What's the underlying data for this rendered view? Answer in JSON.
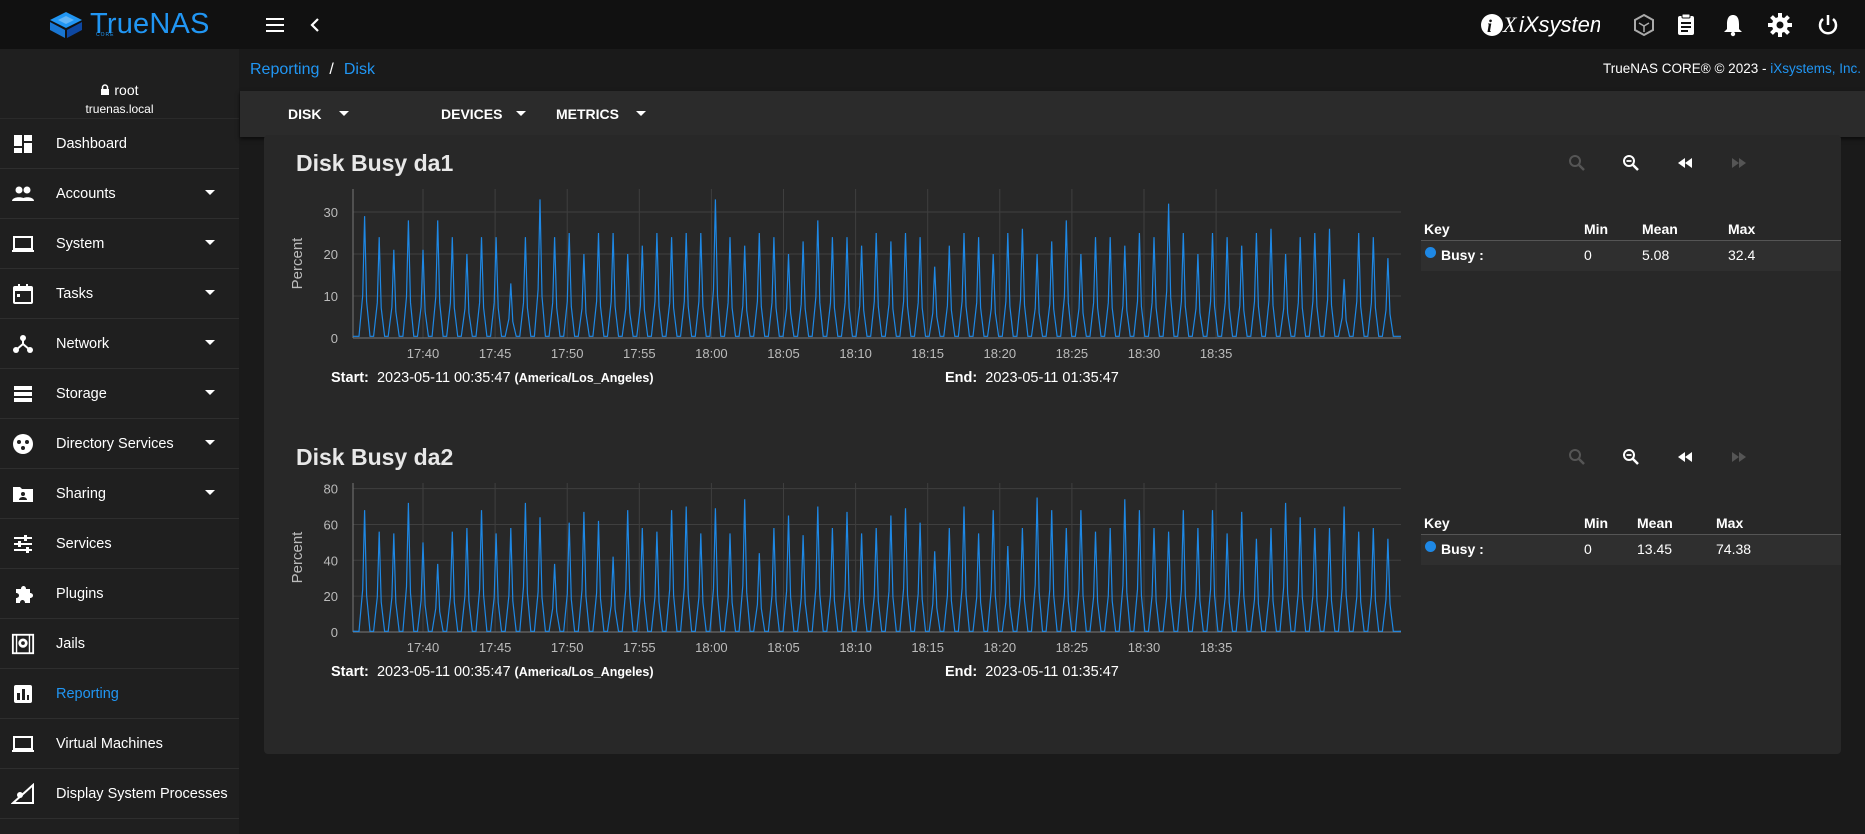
{
  "app": {
    "logo_text": "TrueNAS",
    "logo_sub": "CORE",
    "vendor_logo": "iXsystems"
  },
  "user": {
    "name": "root",
    "host": "truenas.local"
  },
  "sidebar": {
    "items": [
      {
        "label": "Dashboard",
        "icon": "dashboard-icon",
        "caret": false
      },
      {
        "label": "Accounts",
        "icon": "accounts-icon",
        "caret": true
      },
      {
        "label": "System",
        "icon": "system-icon",
        "caret": true
      },
      {
        "label": "Tasks",
        "icon": "tasks-icon",
        "caret": true
      },
      {
        "label": "Network",
        "icon": "network-icon",
        "caret": true
      },
      {
        "label": "Storage",
        "icon": "storage-icon",
        "caret": true
      },
      {
        "label": "Directory Services",
        "icon": "directory-services-icon",
        "caret": true
      },
      {
        "label": "Sharing",
        "icon": "sharing-icon",
        "caret": true
      },
      {
        "label": "Services",
        "icon": "services-icon",
        "caret": false
      },
      {
        "label": "Plugins",
        "icon": "plugins-icon",
        "caret": false
      },
      {
        "label": "Jails",
        "icon": "jails-icon",
        "caret": false
      },
      {
        "label": "Reporting",
        "icon": "reporting-icon",
        "caret": false,
        "active": true
      },
      {
        "label": "Virtual Machines",
        "icon": "virtual-machines-icon",
        "caret": false
      },
      {
        "label": "Display System Processes",
        "icon": "processes-icon",
        "caret": false
      }
    ]
  },
  "breadcrumb": {
    "parent": "Reporting",
    "separator": "/",
    "current": "Disk"
  },
  "copyright": {
    "text": "TrueNAS CORE® © 2023 - ",
    "link": "iXsystems, Inc."
  },
  "toolbar": {
    "disk": "DISK",
    "devices": "DEVICES",
    "metrics": "METRICS"
  },
  "colors": {
    "accent": "#2196f3",
    "series": "#1e88e5"
  },
  "cards": [
    {
      "title": "Disk Busy da1",
      "start_label": "Start:",
      "start_value": "2023-05-11 00:35:47",
      "timezone": "(America/Los_Angeles)",
      "end_label": "End:",
      "end_value": "2023-05-11 01:35:47",
      "legend": {
        "key": "Key",
        "min": "Min",
        "mean": "Mean",
        "max": "Max",
        "series": "Busy :",
        "min_v": "0",
        "mean_v": "5.08",
        "max_v": "32.4"
      }
    },
    {
      "title": "Disk Busy da2",
      "start_label": "Start:",
      "start_value": "2023-05-11 00:35:47",
      "timezone": "(America/Los_Angeles)",
      "end_label": "End:",
      "end_value": "2023-05-11 01:35:47",
      "legend": {
        "key": "Key",
        "min": "Min",
        "mean": "Mean",
        "max": "Max",
        "series": "Busy :",
        "min_v": "0",
        "mean_v": "13.45",
        "max_v": "74.38"
      }
    }
  ],
  "chart_data": [
    {
      "type": "line",
      "title": "Disk Busy da1",
      "ylabel": "Percent",
      "xlabel": "",
      "ylim": [
        0,
        35
      ],
      "yticks": [
        0,
        10,
        20,
        30
      ],
      "xticks": [
        "17:40",
        "17:45",
        "17:50",
        "17:55",
        "18:00",
        "18:05",
        "18:10",
        "18:15",
        "18:20",
        "18:25",
        "18:30",
        "18:35"
      ],
      "grid": true,
      "series": [
        {
          "name": "Busy",
          "peaks": [
            29,
            24,
            21,
            28,
            21,
            28,
            24,
            20,
            24,
            24,
            13,
            24,
            33,
            24,
            25,
            20,
            25,
            25,
            20,
            22,
            25,
            24,
            25,
            25,
            33,
            24,
            22,
            25,
            24,
            20,
            23,
            28,
            24,
            24,
            22,
            25,
            23,
            25,
            24,
            17,
            22,
            25,
            24,
            20,
            25,
            26,
            20,
            23,
            28,
            20,
            24,
            24,
            22,
            25,
            24,
            32,
            25,
            20,
            25,
            24,
            22,
            25,
            26,
            20,
            24,
            25,
            26,
            14,
            25,
            24,
            19
          ]
        }
      ]
    },
    {
      "type": "line",
      "title": "Disk Busy da2",
      "ylabel": "Percent",
      "xlabel": "",
      "ylim": [
        0,
        82
      ],
      "yticks": [
        0,
        20,
        40,
        60,
        80
      ],
      "xticks": [
        "17:40",
        "17:45",
        "17:50",
        "17:55",
        "18:00",
        "18:05",
        "18:10",
        "18:15",
        "18:20",
        "18:25",
        "18:30",
        "18:35"
      ],
      "grid": true,
      "series": [
        {
          "name": "Busy",
          "peaks": [
            68,
            56,
            55,
            72,
            50,
            38,
            56,
            58,
            68,
            55,
            58,
            72,
            64,
            38,
            61,
            67,
            62,
            42,
            68,
            58,
            56,
            68,
            70,
            55,
            69,
            55,
            74,
            44,
            58,
            65,
            54,
            70,
            58,
            67,
            55,
            58,
            65,
            69,
            61,
            45,
            58,
            70,
            55,
            68,
            48,
            58,
            75,
            68,
            58,
            68,
            56,
            58,
            74,
            68,
            58,
            56,
            68,
            58,
            68,
            55,
            67,
            52,
            58,
            72,
            64,
            58,
            58,
            70,
            56,
            58,
            52
          ]
        }
      ]
    }
  ]
}
